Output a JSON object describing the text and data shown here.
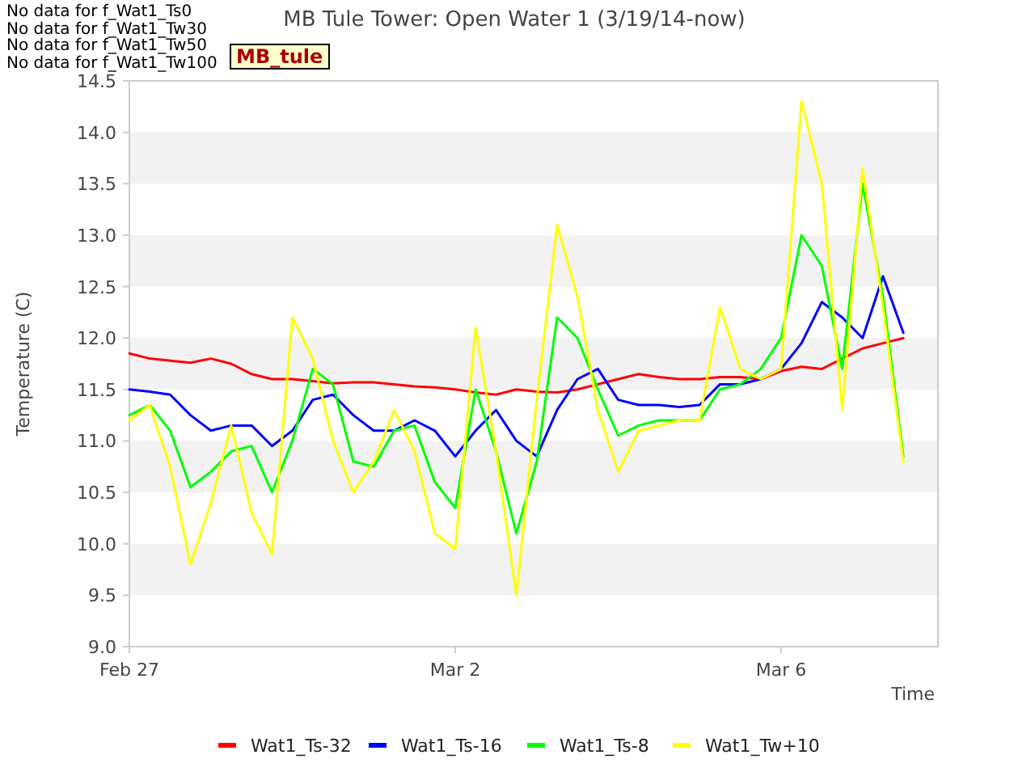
{
  "title": "MB Tule Tower: Open Water 1 (3/19/14-now)",
  "notices": [
    "No data for f_Wat1_Ts0",
    "No data for f_Wat1_Tw30",
    "No data for f_Wat1_Tw50",
    "No data for f_Wat1_Tw100"
  ],
  "badge": "MB_tule",
  "chart_data": {
    "type": "line",
    "xlabel": "Time",
    "ylabel": "Temperature (C)",
    "categories": [
      "Feb 27",
      null,
      null,
      null,
      null,
      null,
      null,
      null,
      null,
      null,
      null,
      null,
      null,
      null,
      null,
      null,
      "Mar 2",
      null,
      null,
      null,
      null,
      null,
      null,
      null,
      null,
      null,
      null,
      null,
      null,
      null,
      null,
      null,
      "Mar 6",
      null,
      null,
      null,
      null,
      null,
      null
    ],
    "ylim": [
      9,
      14.5
    ],
    "yticks": [
      {
        "value": 9,
        "label": "9.0"
      },
      {
        "value": 9.5,
        "label": "9.5"
      },
      {
        "value": 10,
        "label": "10.0"
      },
      {
        "value": 10.5,
        "label": "10.5"
      },
      {
        "value": 11,
        "label": "11.0"
      },
      {
        "value": 11.5,
        "label": "11.5"
      },
      {
        "value": 12,
        "label": "12.0"
      },
      {
        "value": 12.5,
        "label": "12.5"
      },
      {
        "value": 13,
        "label": "13.0"
      },
      {
        "value": 13.5,
        "label": "13.5"
      },
      {
        "value": 14,
        "label": "14.0"
      },
      {
        "value": 14.5,
        "label": "14.5"
      }
    ],
    "series": [
      {
        "name": "Wat1_Ts-32",
        "color": "#ff0000",
        "values": [
          11.85,
          11.8,
          11.78,
          11.76,
          11.8,
          11.75,
          11.65,
          11.6,
          11.6,
          11.58,
          11.56,
          11.57,
          11.57,
          11.55,
          11.53,
          11.52,
          11.5,
          11.47,
          11.45,
          11.5,
          11.48,
          11.47,
          11.5,
          11.55,
          11.6,
          11.65,
          11.62,
          11.6,
          11.6,
          11.62,
          11.62,
          11.6,
          11.68,
          11.72,
          11.7,
          11.8,
          11.9,
          11.95,
          12.0
        ]
      },
      {
        "name": "Wat1_Ts-16",
        "color": "#0000ff",
        "values": [
          11.5,
          11.48,
          11.45,
          11.25,
          11.1,
          11.15,
          11.15,
          10.95,
          11.1,
          11.4,
          11.45,
          11.25,
          11.1,
          11.1,
          11.2,
          11.1,
          10.85,
          11.1,
          11.3,
          11.0,
          10.85,
          11.3,
          11.6,
          11.7,
          11.4,
          11.35,
          11.35,
          11.33,
          11.35,
          11.55,
          11.55,
          11.6,
          11.7,
          11.95,
          12.35,
          12.2,
          12.0,
          12.6,
          12.05
        ]
      },
      {
        "name": "Wat1_Ts-8",
        "color": "#00ff00",
        "values": [
          11.25,
          11.35,
          11.1,
          10.55,
          10.7,
          10.9,
          10.95,
          10.5,
          11.0,
          11.7,
          11.55,
          10.8,
          10.75,
          11.1,
          11.15,
          10.6,
          10.35,
          11.5,
          10.9,
          10.1,
          10.8,
          12.2,
          12.0,
          11.5,
          11.05,
          11.15,
          11.2,
          11.2,
          11.2,
          11.5,
          11.55,
          11.7,
          12.0,
          13.0,
          12.7,
          11.7,
          13.5,
          12.4,
          10.85
        ]
      },
      {
        "name": "Wat1_Tw+10",
        "color": "#ffff00",
        "values": [
          11.2,
          11.35,
          10.75,
          9.8,
          10.4,
          11.15,
          10.3,
          9.9,
          12.2,
          11.8,
          11.0,
          10.5,
          10.8,
          11.3,
          10.9,
          10.1,
          9.95,
          12.1,
          10.9,
          9.5,
          11.4,
          13.1,
          12.4,
          11.3,
          10.7,
          11.1,
          11.15,
          11.2,
          11.2,
          12.3,
          11.7,
          11.6,
          11.7,
          14.3,
          13.5,
          11.3,
          13.65,
          12.3,
          10.8
        ]
      }
    ]
  }
}
